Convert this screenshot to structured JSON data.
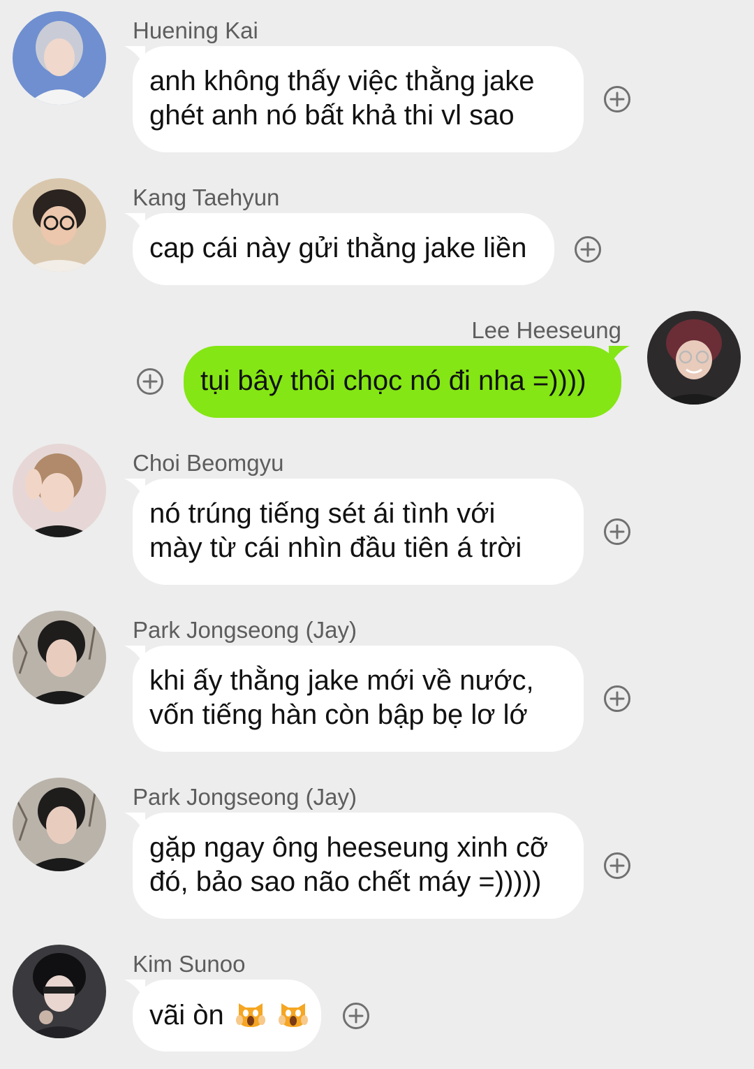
{
  "colors": {
    "background": "#ededed",
    "incoming_bubble": "#ffffff",
    "outgoing_bubble": "#84e614",
    "sender_name": "#5d5d5d",
    "message_text": "#111111",
    "react_icon": "#707070"
  },
  "messages": [
    {
      "sender": "Huening Kai",
      "direction": "incoming",
      "lines": [
        "anh không thấy việc thằng jake",
        "ghét anh nó bất khả thi vl sao"
      ]
    },
    {
      "sender": "Kang Taehyun",
      "direction": "incoming",
      "lines": [
        "cap cái này gửi thằng jake liền"
      ]
    },
    {
      "sender": "Lee Heeseung",
      "direction": "outgoing",
      "lines": [
        "tụi bây thôi chọc nó đi nha =))))"
      ]
    },
    {
      "sender": "Choi Beomgyu",
      "direction": "incoming",
      "lines": [
        "nó trúng tiếng sét ái tình với",
        "mày từ cái nhìn đầu tiên á trời"
      ]
    },
    {
      "sender": "Park Jongseong (Jay)",
      "direction": "incoming",
      "lines": [
        "khi ấy thằng jake mới về nước,",
        "vốn tiếng hàn còn bập bẹ lơ lớ"
      ]
    },
    {
      "sender": "Park Jongseong (Jay)",
      "direction": "incoming",
      "lines": [
        "gặp ngay ông heeseung xinh cỡ",
        "đó, bảo sao não chết máy =)))))"
      ]
    },
    {
      "sender": "Kim Sunoo",
      "direction": "incoming",
      "lines": [
        "vãi òn"
      ],
      "emoji": [
        "scream-cat-emoji",
        "scream-cat-emoji"
      ]
    }
  ],
  "icons": {
    "react": "plus-circle-icon",
    "avatar": "avatar-photo"
  }
}
